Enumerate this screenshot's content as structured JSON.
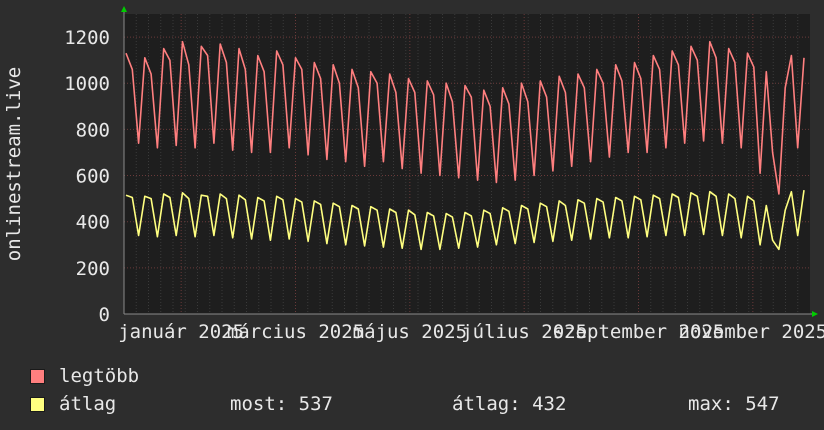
{
  "chart_data": {
    "type": "line",
    "ylabel": "onlinestream.live",
    "ylim": [
      0,
      1300
    ],
    "y_ticks": [
      0,
      200,
      400,
      600,
      800,
      1000,
      1200
    ],
    "x_ticks": [
      "január 2025",
      "március 2025",
      "május 2025",
      "július 2025",
      "szeptember 2025",
      "november 2025"
    ],
    "grid": true,
    "series": [
      {
        "name": "legtöbb",
        "color": "#ff7f7f",
        "values": [
          1130,
          1060,
          740,
          1110,
          1040,
          720,
          1150,
          1100,
          730,
          1180,
          1080,
          720,
          1160,
          1120,
          740,
          1170,
          1090,
          710,
          1150,
          1060,
          700,
          1120,
          1050,
          700,
          1140,
          1080,
          720,
          1110,
          1060,
          690,
          1090,
          1020,
          670,
          1080,
          1000,
          660,
          1060,
          980,
          640,
          1050,
          1000,
          660,
          1040,
          960,
          630,
          1020,
          960,
          610,
          1010,
          950,
          600,
          1000,
          920,
          590,
          990,
          940,
          580,
          970,
          900,
          570,
          980,
          910,
          580,
          1000,
          920,
          600,
          1010,
          940,
          620,
          1030,
          960,
          640,
          1040,
          980,
          660,
          1060,
          1000,
          680,
          1080,
          1010,
          700,
          1090,
          1020,
          700,
          1120,
          1060,
          720,
          1140,
          1080,
          740,
          1160,
          1100,
          750,
          1180,
          1110,
          740,
          1150,
          1090,
          720,
          1130,
          1070,
          610,
          1050,
          700,
          520,
          980,
          1120,
          720,
          1110
        ]
      },
      {
        "name": "átlag",
        "color": "#ffff80",
        "values": [
          515,
          505,
          340,
          510,
          500,
          335,
          520,
          505,
          340,
          525,
          500,
          335,
          515,
          510,
          340,
          520,
          500,
          330,
          515,
          495,
          325,
          505,
          490,
          320,
          510,
          495,
          325,
          500,
          485,
          315,
          490,
          475,
          305,
          480,
          465,
          300,
          470,
          455,
          295,
          465,
          450,
          290,
          455,
          440,
          285,
          450,
          430,
          280,
          440,
          425,
          280,
          435,
          420,
          285,
          440,
          425,
          290,
          450,
          435,
          300,
          460,
          445,
          305,
          470,
          455,
          310,
          480,
          465,
          315,
          490,
          470,
          320,
          495,
          480,
          325,
          500,
          485,
          330,
          505,
          490,
          330,
          510,
          495,
          335,
          515,
          500,
          340,
          520,
          505,
          340,
          525,
          510,
          345,
          530,
          510,
          340,
          520,
          500,
          330,
          510,
          490,
          300,
          470,
          320,
          280,
          450,
          530,
          340,
          537
        ]
      }
    ]
  },
  "legend": {
    "items": [
      {
        "label": "legtöbb",
        "color": "#ff7f7f"
      },
      {
        "label": "átlag",
        "color": "#ffff80"
      }
    ],
    "stats": {
      "most_label": "most:",
      "most_value": "537",
      "atlag_label": "átlag:",
      "atlag_value": "432",
      "max_label": "max:",
      "max_value": "547"
    }
  },
  "colors": {
    "background": "#2d2d2d",
    "plot_background": "#1e1e1e",
    "grid": "#444444",
    "axis": "#8a8a8a",
    "text": "#e8e8e8",
    "arrow": "#00cc00"
  }
}
